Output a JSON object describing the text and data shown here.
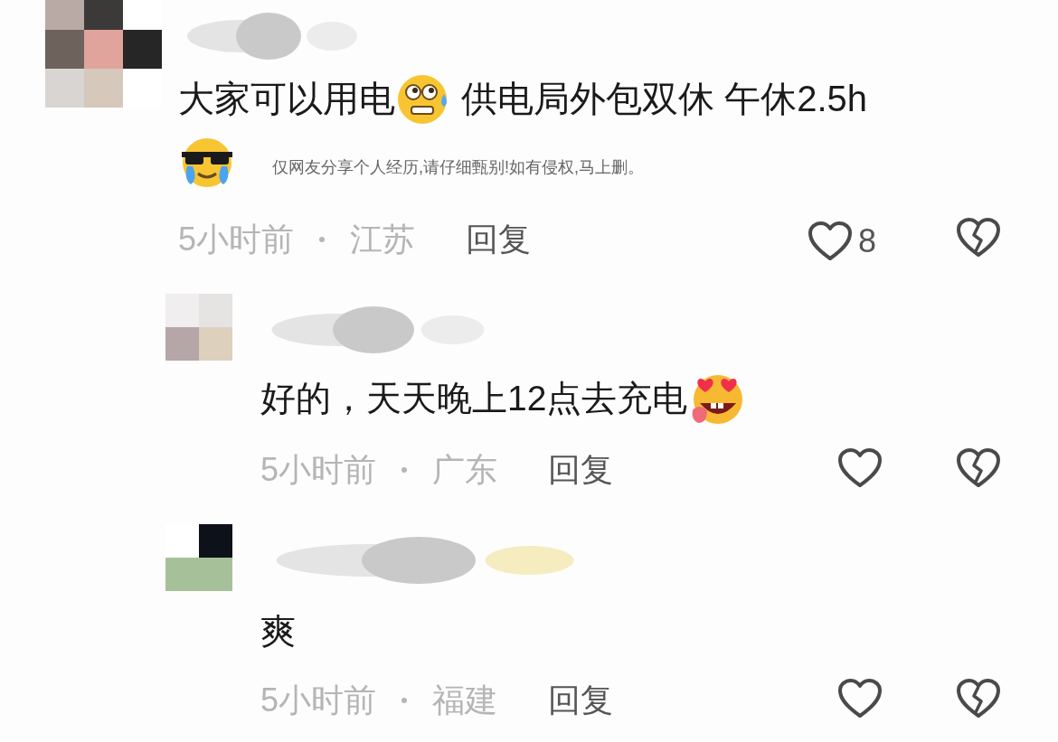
{
  "comments": [
    {
      "kind": "comment",
      "body": [
        {
          "kind": "text",
          "text": "大家可以用电"
        },
        {
          "kind": "emoji"
        },
        {
          "kind": "text",
          "text": " 供电局外包双休 午休2.5h"
        }
      ],
      "extra_emoji": true,
      "caption": "仅网友分享个人经历,请仔细甄别!如有侵权,马上删。",
      "time": "5小时前",
      "location": "江苏",
      "reply": "回复",
      "likes": "8"
    },
    {
      "kind": "reply",
      "body": [
        {
          "kind": "text",
          "text": "好的，天天晚上12点去充电"
        },
        {
          "kind": "emoji"
        }
      ],
      "time": "5小时前",
      "location": "广东",
      "reply": "回复"
    },
    {
      "kind": "reply",
      "body": [
        {
          "kind": "text",
          "text": "爽"
        }
      ],
      "time": "5小时前",
      "location": "福建",
      "reply": "回复"
    }
  ]
}
